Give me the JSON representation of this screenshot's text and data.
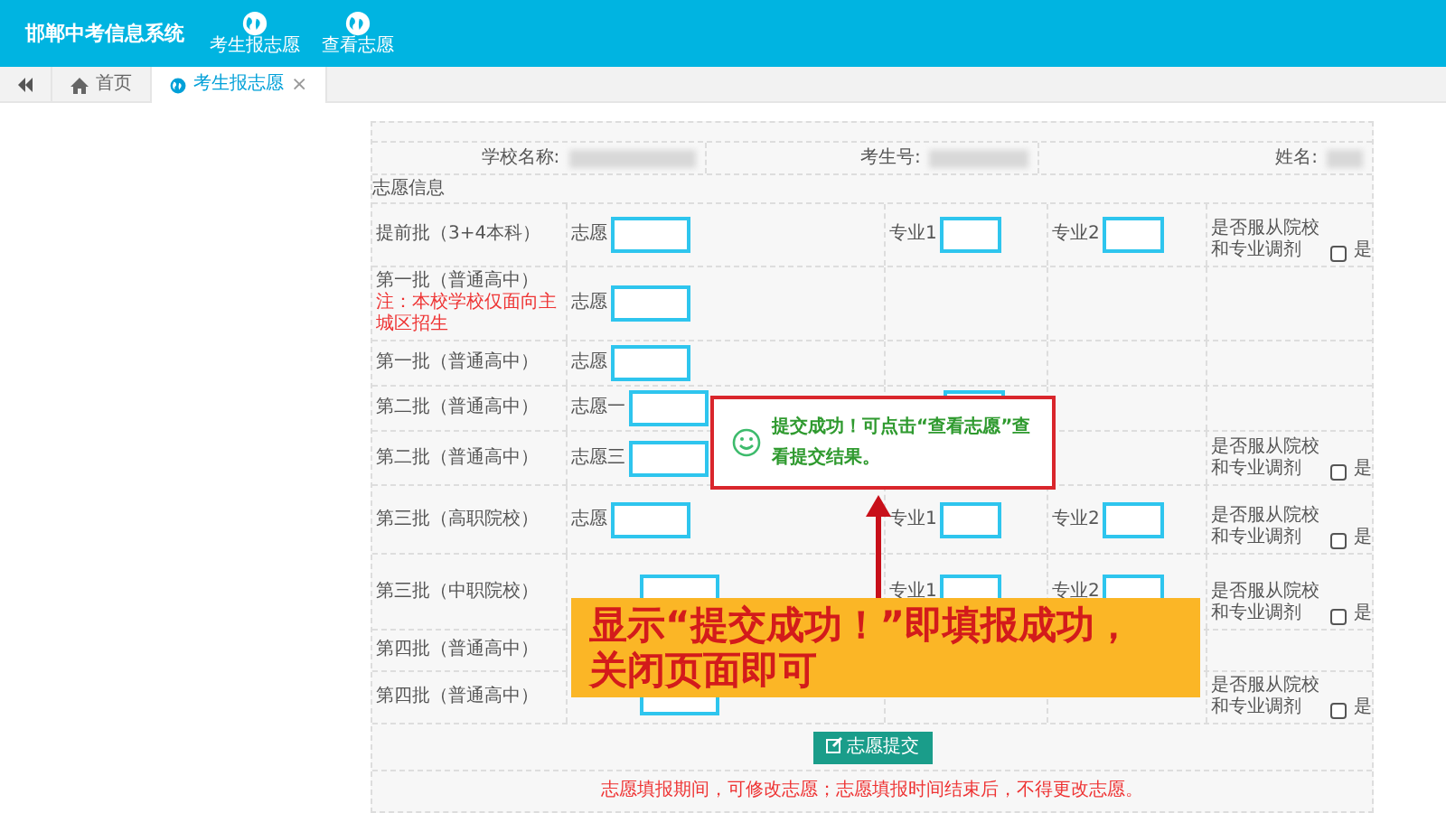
{
  "app": {
    "title": "邯郸中考信息系统",
    "nav": [
      {
        "label": "考生报志愿"
      },
      {
        "label": "查看志愿"
      }
    ]
  },
  "tabs": [
    {
      "label": "首页",
      "kind": "home",
      "selected": false,
      "closable": false
    },
    {
      "label": "考生报志愿",
      "kind": "page",
      "selected": true,
      "closable": true
    }
  ],
  "close_glyph": "×",
  "info": [
    {
      "label": "学校名称:"
    },
    {
      "label": "考生号:"
    },
    {
      "label": "姓名:"
    }
  ],
  "section_title": "志愿信息",
  "rows": [
    {
      "label": "提前批（3+4本科）",
      "fields": [
        {
          "kind": "choice",
          "label": "志愿"
        },
        {
          "kind": "major1",
          "label": "专业1"
        },
        {
          "kind": "major2",
          "label": "专业2"
        }
      ],
      "adjust": {
        "label": "是否服从院校和专业调剂",
        "option": "是",
        "checked": false
      }
    },
    {
      "label": "第一批（普通高中）",
      "note": "注：本校学校仅面向主城区招生",
      "fields": [
        {
          "kind": "choice",
          "label": "志愿"
        }
      ]
    },
    {
      "label": "第一批（普通高中）",
      "fields": [
        {
          "kind": "choice",
          "label": "志愿"
        }
      ]
    },
    {
      "label": "第二批（普通高中）",
      "fields": [
        {
          "kind": "choice",
          "label": "志愿一"
        },
        {
          "kind": "major1"
        }
      ]
    },
    {
      "label": "第二批（普通高中）",
      "fields": [
        {
          "kind": "choice",
          "label": "志愿三"
        }
      ],
      "adjust": {
        "label": "是否服从院校和专业调剂",
        "option": "是",
        "checked": false
      }
    },
    {
      "label": "第三批（高职院校）",
      "fields": [
        {
          "kind": "choice",
          "label": "志愿"
        },
        {
          "kind": "major1",
          "label": "专业1"
        },
        {
          "kind": "major2",
          "label": "专业2"
        }
      ],
      "adjust": {
        "label": "是否服从院校和专业调剂",
        "option": "是",
        "checked": false
      }
    },
    {
      "label": "第三批（中职院校）",
      "fields": [
        {
          "kind": "choice"
        },
        {
          "kind": "major1",
          "label": "专业1"
        },
        {
          "kind": "major2",
          "label": "专业2"
        }
      ],
      "adjust": {
        "label": "是否服从院校和专业调剂",
        "option": "是",
        "checked": false
      }
    },
    {
      "label": "第四批（普通高中）",
      "fields": []
    },
    {
      "label": "第四批（普通高中）",
      "fields": [
        {
          "kind": "choice"
        }
      ],
      "adjust": {
        "label": "是否服从院校和专业调剂",
        "option": "是",
        "checked": false
      }
    }
  ],
  "submit_button": "志愿提交",
  "footer_note": "志愿填报期间，可修改志愿；志愿填报时间结束后，不得更改志愿。",
  "dialog": {
    "message": "提交成功！可点击“查看志愿”查看提交结果。"
  },
  "callout": {
    "lines": [
      "显示“提交成功！”即填报成功，",
      "关闭页面即可"
    ]
  }
}
